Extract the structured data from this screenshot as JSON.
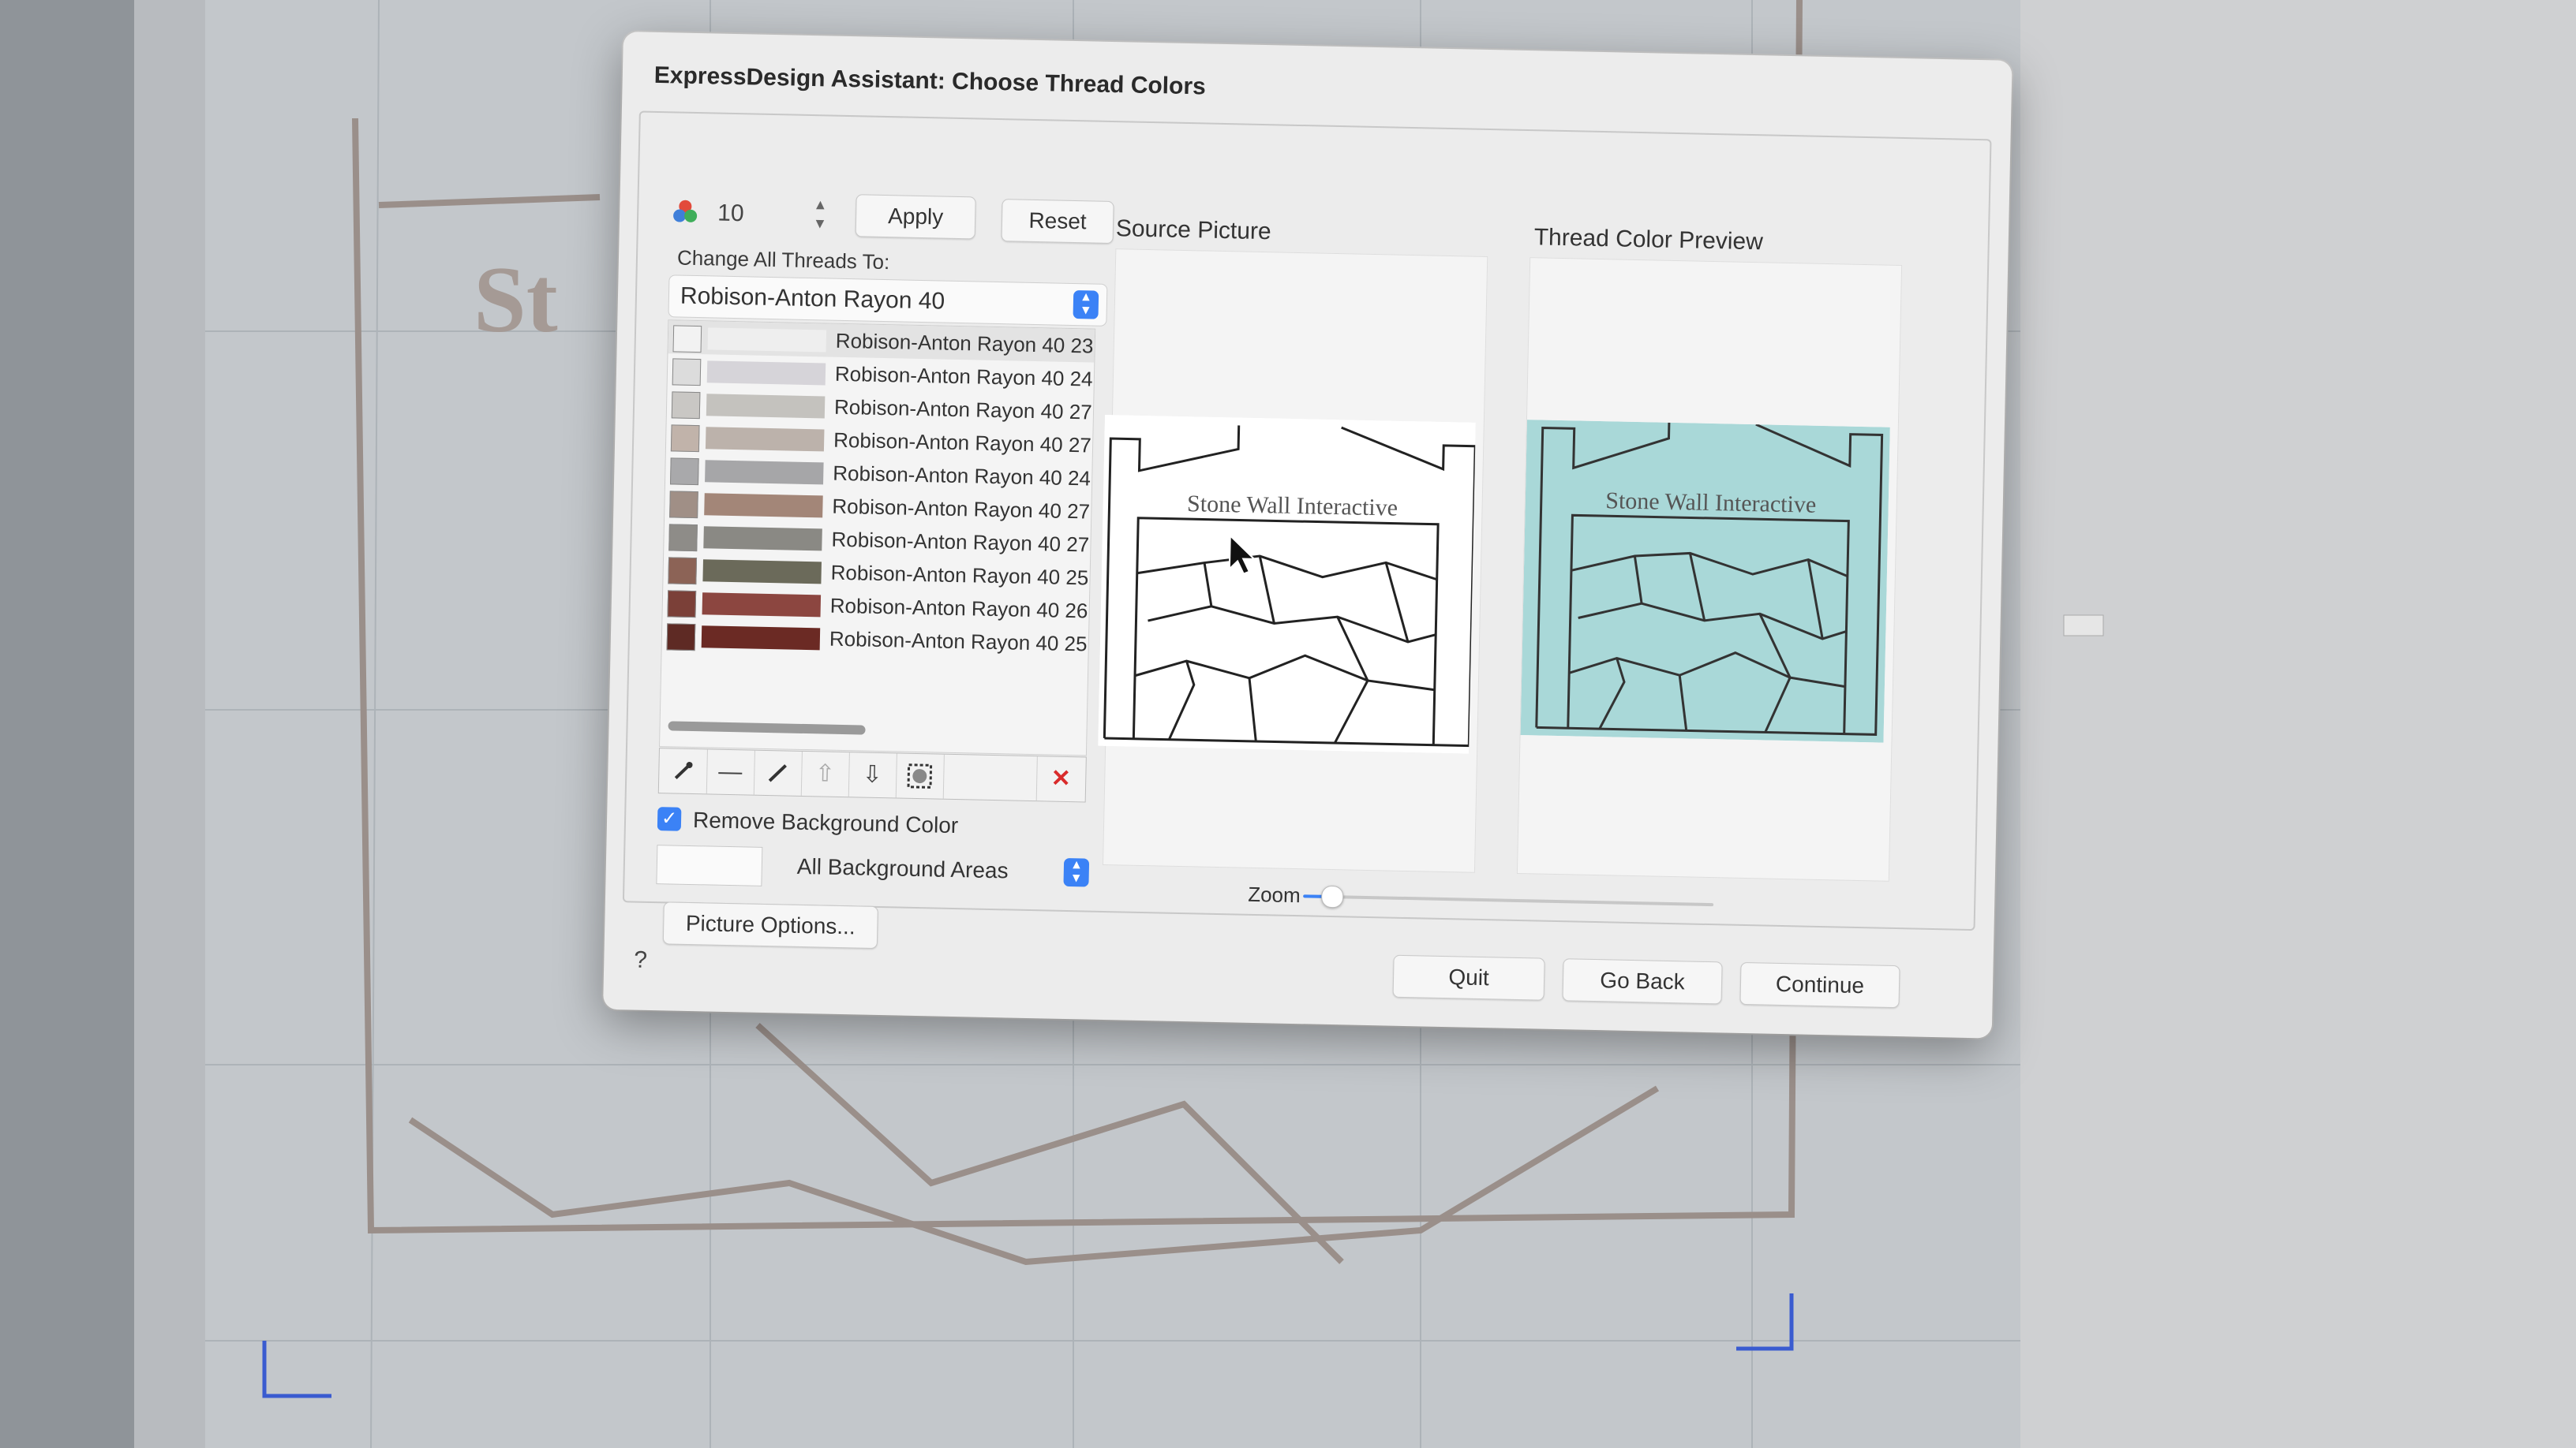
{
  "dialog": {
    "title": "ExpressDesign Assistant: Choose Thread Colors"
  },
  "color_count": {
    "value": "10",
    "icon": "color-dots-icon"
  },
  "buttons": {
    "apply": "Apply",
    "reset": "Reset",
    "picture_options": "Picture Options...",
    "quit": "Quit",
    "go_back": "Go Back",
    "continue": "Continue",
    "help": "?"
  },
  "change_all": {
    "label": "Change All Threads To:",
    "selected": "Robison-Anton Rayon 40"
  },
  "threads": [
    {
      "label": "Robison-Anton Rayon 40 23",
      "chip": "#f2f2f2",
      "bar": "#eeeeee"
    },
    {
      "label": "Robison-Anton Rayon 40 24",
      "chip": "#dcdcdc",
      "bar": "#d6d4d9"
    },
    {
      "label": "Robison-Anton Rayon 40 27",
      "chip": "#c9c7c4",
      "bar": "#c4c2be"
    },
    {
      "label": "Robison-Anton Rayon 40 27",
      "chip": "#c1b3aa",
      "bar": "#bcb2ab"
    },
    {
      "label": "Robison-Anton Rayon 40 24",
      "chip": "#a9a9ab",
      "bar": "#a6a6a8"
    },
    {
      "label": "Robison-Anton Rayon 40 27",
      "chip": "#a08f86",
      "bar": "#a38678"
    },
    {
      "label": "Robison-Anton Rayon 40 27",
      "chip": "#8e8c88",
      "bar": "#8a8984"
    },
    {
      "label": "Robison-Anton Rayon 40 25",
      "chip": "#8c6356",
      "bar": "#6b6a5a"
    },
    {
      "label": "Robison-Anton Rayon 40 26",
      "chip": "#7b4038",
      "bar": "#8c4640"
    },
    {
      "label": "Robison-Anton Rayon 40 25",
      "chip": "#5e2a24",
      "bar": "#6b2a24"
    }
  ],
  "toolbar": [
    "eyedropper-icon",
    "minus-icon",
    "pencil-icon",
    "arrow-up-icon",
    "arrow-down-icon",
    "select-all-icon",
    "delete-icon"
  ],
  "background": {
    "checkbox_label": "Remove Background Color",
    "checked": true,
    "area_option": "All Background Areas"
  },
  "panes": {
    "source_title": "Source Picture",
    "preview_title": "Thread Color Preview",
    "design_text": "Stone Wall Interactive",
    "preview_color": "#a9d8d8"
  },
  "zoom": {
    "label": "Zoom",
    "value": 0.05
  },
  "colors": {
    "accent": "#3b82f6",
    "delete": "#d92b2b"
  }
}
